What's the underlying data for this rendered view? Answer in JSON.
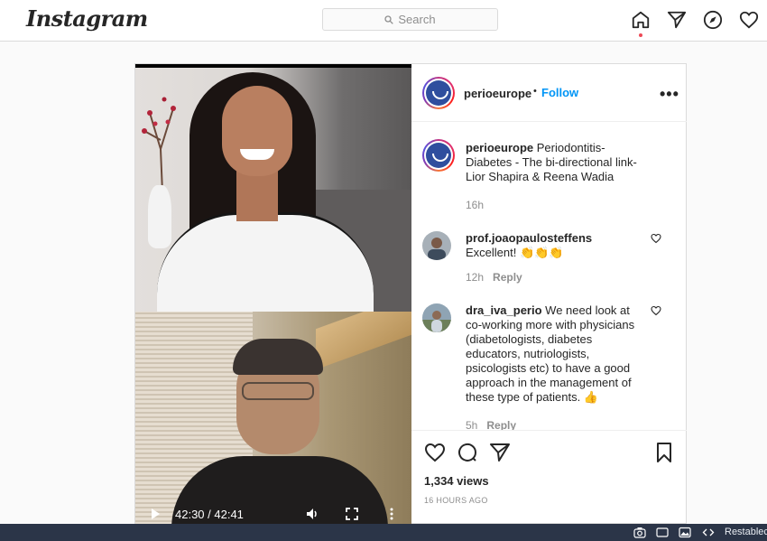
{
  "app": {
    "logo": "Instagram"
  },
  "search": {
    "placeholder": "Search",
    "icon": "search-icon"
  },
  "nav": {
    "icons": [
      "home-icon",
      "direct-icon",
      "explore-icon",
      "activity-heart-icon"
    ],
    "active_dot_color": "#ed4956"
  },
  "post": {
    "author": "perioeurope",
    "separator": "•",
    "follow_label": "Follow",
    "more_label": "•••",
    "caption_author": "perioeurope",
    "caption": "Periodontitis-Diabetes - The bi-directional link-Lior Shapira & Reena Wadia",
    "caption_time": "16h",
    "video": {
      "timecode": "42:30 / 42:41"
    },
    "comments": [
      {
        "user": "prof.joaopaulosteffens",
        "text": "Excellent! 👏👏👏",
        "time": "12h",
        "reply_label": "Reply"
      },
      {
        "user": "dra_iva_perio",
        "text": "We need look at co-working more with physicians (diabetologists, diabetes educators, nutriologists, psicologists etc) to have a good approach in the management of these type of patients. 👍",
        "time": "5h",
        "reply_label": "Reply"
      }
    ],
    "views": "1,334 views",
    "posted_ago": "16 HOURS AGO"
  },
  "colors": {
    "link": "#0095f6",
    "muted": "#8e8e8e",
    "text": "#262626",
    "browser_bar": "#2b3548"
  },
  "browser_bar": {
    "label": "Restablec"
  }
}
